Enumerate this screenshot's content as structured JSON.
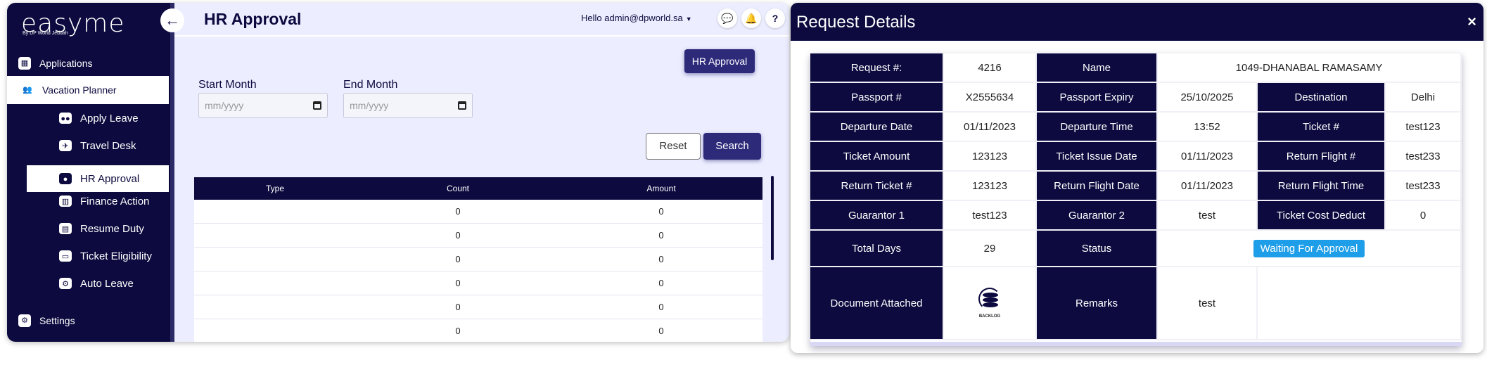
{
  "app": {
    "logo": "easyme",
    "logo_subtitle": "By DP World Jeddah",
    "back_icon": "arrow-left-icon",
    "nav": {
      "applications": "Applications",
      "vacation_planner": "Vacation Planner",
      "settings": "Settings"
    },
    "sub_nav": [
      {
        "label": "Apply Leave",
        "icon": "users-icon"
      },
      {
        "label": "Travel Desk",
        "icon": "plane-icon"
      },
      {
        "label": "HR Approval",
        "icon": "person-icon",
        "active": true
      },
      {
        "label": "Finance Action",
        "icon": "bank-icon"
      },
      {
        "label": "Resume Duty",
        "icon": "id-card-icon"
      },
      {
        "label": "Ticket Eligibility",
        "icon": "ticket-icon"
      },
      {
        "label": "Auto Leave",
        "icon": "gears-icon"
      }
    ],
    "page_title": "HR Approval",
    "greeting": "Hello admin@dpworld.sa",
    "hr_chip": "HR Approval",
    "start_month_label": "Start Month",
    "start_month_placeholder": "mm/yyyy",
    "end_month_label": "End Month",
    "end_month_placeholder": "mm/yyyy",
    "reset_label": "Reset",
    "search_label": "Search",
    "grid": {
      "headers": [
        "Type",
        "Count",
        "Amount"
      ],
      "rows": [
        [
          "",
          "0",
          "0"
        ],
        [
          "",
          "0",
          "0"
        ],
        [
          "",
          "0",
          "0"
        ],
        [
          "",
          "0",
          "0"
        ],
        [
          "",
          "0",
          "0"
        ],
        [
          "",
          "0",
          "0"
        ]
      ]
    }
  },
  "modal": {
    "title": "Request Details",
    "close": "×",
    "request_no_label": "Request #:",
    "request_no": "4216",
    "name_label": "Name",
    "name": "1049-DHANABAL RAMASAMY",
    "passport_label": "Passport #",
    "passport": "X2555634",
    "passport_expiry_label": "Passport Expiry",
    "passport_expiry": "25/10/2025",
    "destination_label": "Destination",
    "destination": "Delhi",
    "departure_date_label": "Departure Date",
    "departure_date": "01/11/2023",
    "departure_time_label": "Departure Time",
    "departure_time": "13:52",
    "ticket_no_label": "Ticket #",
    "ticket_no": "test123",
    "ticket_amount_label": "Ticket Amount",
    "ticket_amount": "123123",
    "ticket_issue_date_label": "Ticket Issue Date",
    "ticket_issue_date": "01/11/2023",
    "return_flight_no_label": "Return Flight #",
    "return_flight_no": "test233",
    "return_ticket_no_label": "Return Ticket #",
    "return_ticket_no": "123123",
    "return_flight_date_label": "Return Flight Date",
    "return_flight_date": "01/11/2023",
    "return_flight_time_label": "Return Flight Time",
    "return_flight_time": "test233",
    "guarantor1_label": "Guarantor 1",
    "guarantor1": "test123",
    "guarantor2_label": "Guarantor 2",
    "guarantor2": "test",
    "ticket_cost_deduct_label": "Ticket Cost Deduct",
    "ticket_cost_deduct": "0",
    "total_days_label": "Total Days",
    "total_days": "29",
    "status_label": "Status",
    "status": "Waiting For Approval",
    "document_label": "Document Attached",
    "document_caption": "BACKLOG",
    "remarks_label": "Remarks",
    "remarks": "test"
  },
  "colors": {
    "navy": "#0c0a3e",
    "accent": "#2e2a7a",
    "status_blue": "#1e9ee8",
    "page_bg": "#eceeff"
  }
}
